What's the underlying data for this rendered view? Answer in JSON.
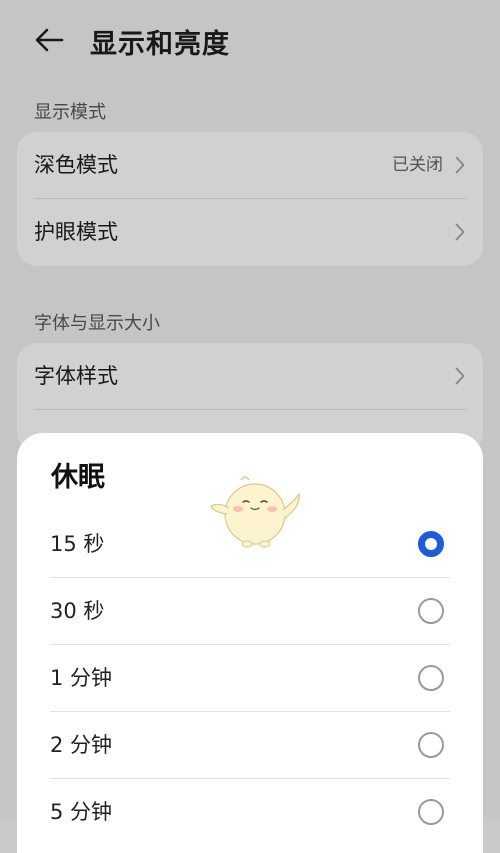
{
  "header": {
    "title": "显示和亮度",
    "back_icon": "arrow-left-icon"
  },
  "sections": [
    {
      "title": "显示模式",
      "items": [
        {
          "label": "深色模式",
          "value": "已关闭",
          "icon": "chevron-right-icon"
        },
        {
          "label": "护眼模式",
          "value": "",
          "icon": "chevron-right-icon"
        }
      ]
    },
    {
      "title": "字体与显示大小",
      "items": [
        {
          "label": "字体样式",
          "value": "",
          "icon": "chevron-right-icon"
        }
      ]
    }
  ],
  "sleep_dialog": {
    "title": "休眠",
    "options": [
      {
        "label": "15 秒",
        "selected": true
      },
      {
        "label": "30 秒",
        "selected": false
      },
      {
        "label": "1 分钟",
        "selected": false
      },
      {
        "label": "2 分钟",
        "selected": false
      },
      {
        "label": "5 分钟",
        "selected": false
      }
    ]
  },
  "colors": {
    "accent": "#1f5bd9",
    "background": "#c9c9cb",
    "card": "#d6d6d8"
  }
}
